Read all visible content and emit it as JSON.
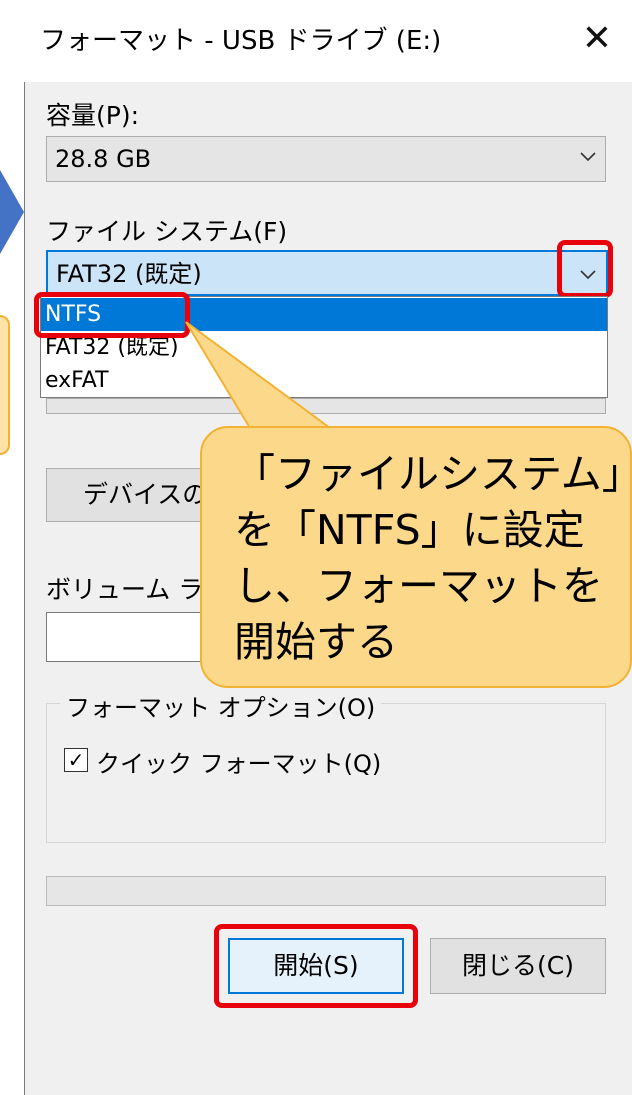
{
  "window": {
    "title": "フォーマット - USB ドライブ (E:)",
    "close_glyph": "✕"
  },
  "capacity": {
    "label": "容量(P):",
    "value": "28.8 GB"
  },
  "filesystem": {
    "label": "ファイル システム(F)",
    "value": "FAT32 (既定)",
    "options": [
      "NTFS",
      "FAT32 (既定)",
      "exFAT"
    ],
    "selected_option": "NTFS"
  },
  "device_defaults_button": "デバイスの既",
  "volume_label": {
    "label": "ボリューム ラベル"
  },
  "format_options": {
    "title": "フォーマット オプション(O)",
    "quick_format_label": "クイック フォーマット(Q)",
    "quick_format_checked": true,
    "check_glyph": "✓"
  },
  "buttons": {
    "start": "開始(S)",
    "close": "閉じる(C)"
  },
  "callout": {
    "text": "「ファイルシステム」を「NTFS」に設定し、フォーマットを開始する"
  },
  "colors": {
    "highlight": "#e8000b",
    "selection": "#0078d7",
    "callout_fill": "#fcd88a"
  }
}
